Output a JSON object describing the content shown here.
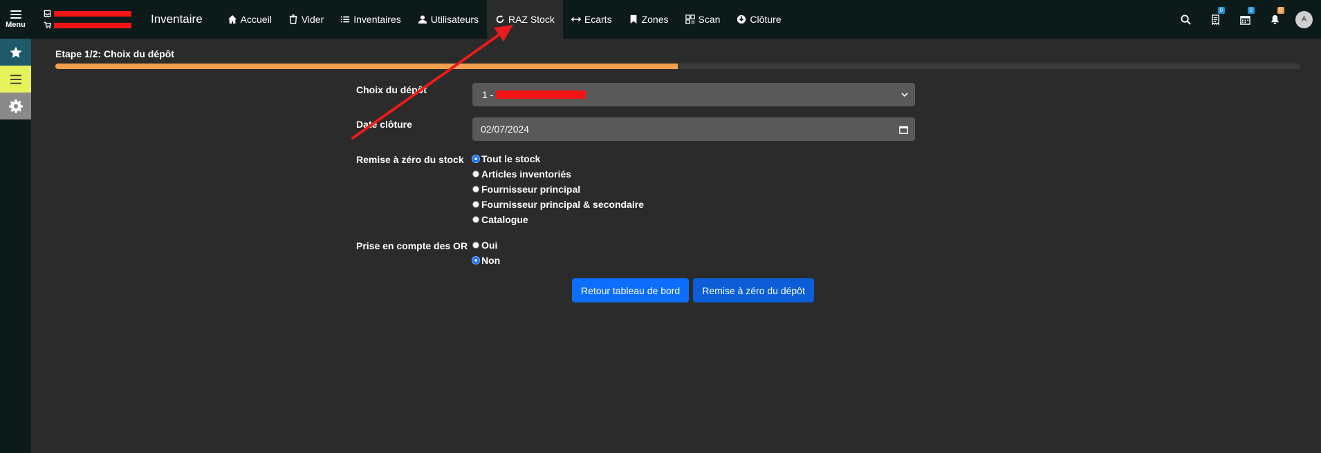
{
  "topbar": {
    "menu_label": "Menu",
    "app_title": "Inventaire",
    "nav": [
      {
        "label": "Accueil",
        "icon": "home-icon"
      },
      {
        "label": "Vider",
        "icon": "trash-icon"
      },
      {
        "label": "Inventaires",
        "icon": "list-icon"
      },
      {
        "label": "Utilisateurs",
        "icon": "user-icon"
      },
      {
        "label": "RAZ Stock",
        "icon": "refresh-icon",
        "active": true
      },
      {
        "label": "Ecarts",
        "icon": "arrows-horizontal-icon"
      },
      {
        "label": "Zones",
        "icon": "bookmark-icon"
      },
      {
        "label": "Scan",
        "icon": "qrcode-icon"
      },
      {
        "label": "Clôture",
        "icon": "download-circle-icon"
      }
    ],
    "badges": {
      "receipts": "0",
      "calendar": "0",
      "notifications": "0"
    },
    "avatar_initial": "A"
  },
  "step": {
    "title": "Etape 1/2: Choix du dépôt",
    "progress": 0.5
  },
  "form": {
    "depot_label": "Choix du dépôt",
    "depot_value": "1 -",
    "date_label": "Date clôture",
    "date_value": "02/07/2024",
    "reset_label": "Remise à zéro du stock",
    "reset_options": [
      {
        "label": "Tout le stock",
        "checked": true
      },
      {
        "label": "Articles inventoriés",
        "checked": false
      },
      {
        "label": "Fournisseur principal",
        "checked": false
      },
      {
        "label": "Fournisseur principal & secondaire",
        "checked": false
      },
      {
        "label": "Catalogue",
        "checked": false
      }
    ],
    "or_label": "Prise en compte des OR",
    "or_options": [
      {
        "label": "Oui",
        "checked": false
      },
      {
        "label": "Non",
        "checked": true
      }
    ]
  },
  "buttons": {
    "back": "Retour tableau de bord",
    "reset": "Remise à zéro du dépôt"
  },
  "colors": {
    "accent": "#0d6efd",
    "progress": "#f0a050",
    "badge_blue": "#1e8fd6",
    "badge_orange": "#f0a050",
    "annotation": "#e81c1c"
  }
}
